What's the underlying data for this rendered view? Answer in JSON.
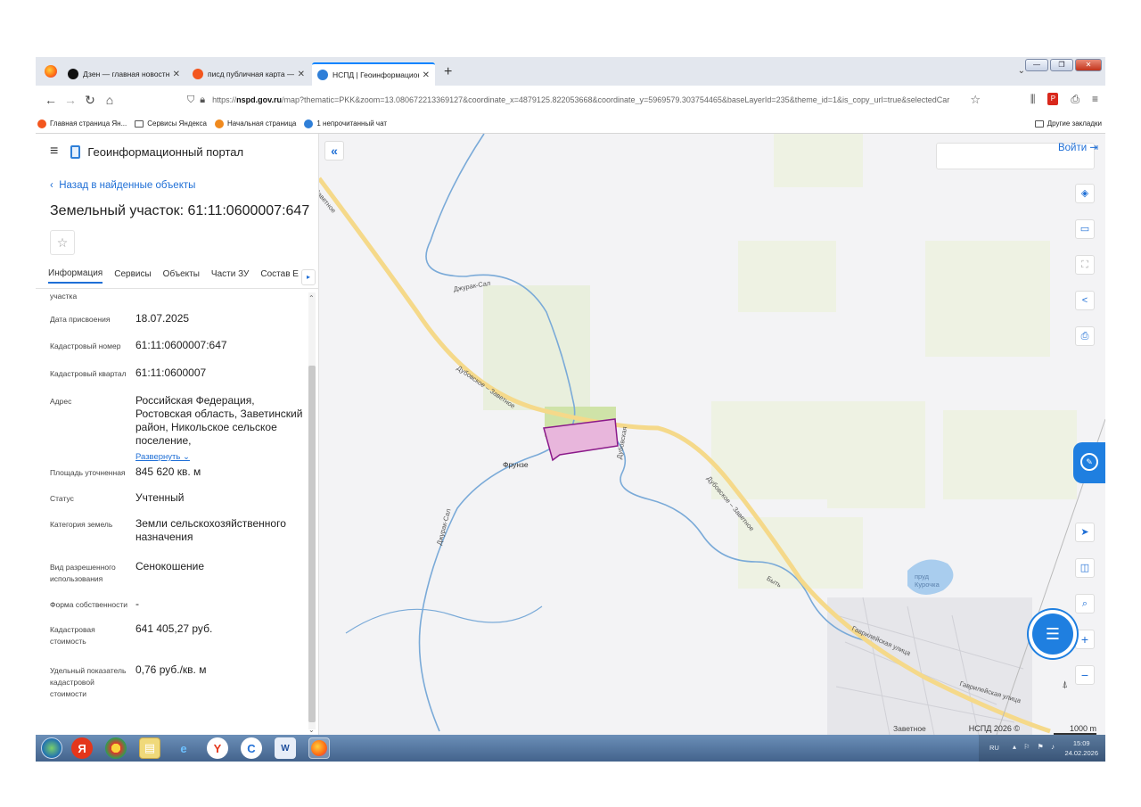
{
  "browser": {
    "tabs": [
      {
        "title": "Дзен — главная новостная и",
        "icon_color": "#111111",
        "active": false
      },
      {
        "title": "писд публичная карта — Яндекс",
        "icon_color": "#f3561e",
        "active": false
      },
      {
        "title": "НСПД | Геоинформационный",
        "icon_color": "#2f7fd8",
        "active": true
      }
    ],
    "new_tab": "+",
    "tabs_menu": "⌄",
    "window_buttons": [
      "—",
      "❐",
      "✕"
    ],
    "url_prefix": "https://",
    "url_host": "nspd.gov.ru",
    "url_rest": "/map?thematic=PKK&zoom=13.080672213369127&coordinate_x=4879125.822053668&coordinate_y=5969579.303754465&baseLayerId=235&theme_id=1&is_copy_url=true&selectedCar",
    "bookmarks": [
      {
        "label": "Главная страница Ян...",
        "kind": "yandex",
        "color": "#f3561e"
      },
      {
        "label": "Сервисы Яндекса",
        "kind": "folder"
      },
      {
        "label": "Начальная страница",
        "kind": "ff",
        "color": "#f08a1e"
      },
      {
        "label": "1 непрочитанный чат",
        "kind": "chat",
        "color": "#2f7fd8"
      }
    ],
    "other_bookmarks": "Другие закладки"
  },
  "sidebar": {
    "portal_title": "Геоинформационный портал",
    "back_link": "Назад в найденные объекты",
    "parcel_title": "Земельный участок: 61:11:0600007:647",
    "tabs": [
      "Информация",
      "Сервисы",
      "Объекты",
      "Части ЗУ",
      "Состав Е"
    ],
    "tabs_arrow": "▸",
    "props": [
      {
        "label": "участка",
        "value": ""
      },
      {
        "label": "Дата присвоения",
        "value": "18.07.2025"
      },
      {
        "label": "Кадастровый номер",
        "value": "61:11:0600007:647"
      },
      {
        "label": "Кадастровый квартал",
        "value": "61:11:0600007"
      },
      {
        "label": "Адрес",
        "value": "Российская Федерация, Ростовская область, Заветинский район, Никольское сельское поселение,",
        "more": "Развернуть ⌄"
      },
      {
        "label": "Площадь уточненная",
        "value": "845 620 кв. м"
      },
      {
        "label": "Статус",
        "value": "Учтенный"
      },
      {
        "label": "Категория земель",
        "value": "Земли сельскохозяйственного назначения"
      },
      {
        "label": "Вид разрешенного использования",
        "value": "Сенокошение"
      },
      {
        "label": "Форма собственности",
        "value": "-"
      },
      {
        "label": "Кадастровая стоимость",
        "value": "641 405,27 руб."
      },
      {
        "label": "Удельный показатель кадастровой стоимости",
        "value": "0,76 руб./кв. м"
      }
    ]
  },
  "map": {
    "collapse": "«",
    "login": "Войти ⇥",
    "labels": {
      "road_upper": "Заветное",
      "road_mid": "Дубовское – Заветное",
      "road_lower": "Дубовское – Заветное",
      "river_1": "Джурак-Сал",
      "river_2": "Джурак-Сал",
      "river_3": "Дубовская",
      "river_4": "Быть",
      "village": "Фрунзе",
      "pond": "пруд Курочка",
      "street_1": "Гаврилейская улица",
      "street_2": "Гаврилейская улица",
      "town": "Заветное"
    },
    "copyright": "НСПД 2026 ©",
    "scale": "1000 m",
    "colors": {
      "parcel_fill": "#e8b6dc",
      "parcel_stroke": "#8b1a8a",
      "road": "#f5d98a",
      "river": "#7aaad8",
      "accent": "#1f7fe0"
    }
  },
  "taskbar": {
    "language": "RU",
    "time": "15:09",
    "date": "24.02.2026"
  }
}
